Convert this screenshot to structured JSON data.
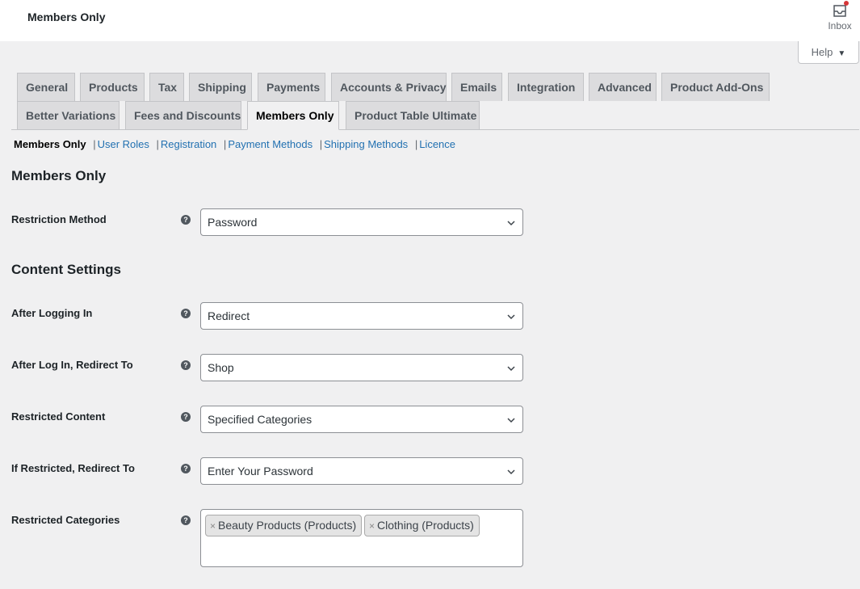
{
  "header": {
    "title": "Members Only",
    "inbox_label": "Inbox",
    "inbox_icon": "inbox-icon",
    "notification_color": "#d63638",
    "help_label": "Help",
    "help_caret": "▼"
  },
  "tabs": [
    {
      "label": "General"
    },
    {
      "label": "Products"
    },
    {
      "label": "Tax"
    },
    {
      "label": "Shipping"
    },
    {
      "label": "Payments"
    },
    {
      "label": "Accounts & Privacy"
    },
    {
      "label": "Emails"
    },
    {
      "label": "Integration"
    },
    {
      "label": "Advanced"
    },
    {
      "label": "Product Add-Ons"
    },
    {
      "label": "Better Variations"
    },
    {
      "label": "Fees and Discounts"
    },
    {
      "label": "Members Only",
      "active": true
    },
    {
      "label": "Product Table Ultimate"
    }
  ],
  "subnav": {
    "current": "Members Only",
    "links": [
      "User Roles",
      "Registration",
      "Payment Methods",
      "Shipping Methods",
      "Licence"
    ],
    "separator": "|"
  },
  "sections": {
    "members_only": {
      "heading": "Members Only",
      "restriction_method": {
        "label": "Restriction Method",
        "value": "Password"
      }
    },
    "content_settings": {
      "heading": "Content Settings",
      "after_logging_in": {
        "label": "After Logging In",
        "value": "Redirect"
      },
      "after_login_redirect": {
        "label": "After Log In, Redirect To",
        "value": "Shop"
      },
      "restricted_content": {
        "label": "Restricted Content",
        "value": "Specified Categories"
      },
      "if_restricted_redirect": {
        "label": "If Restricted, Redirect To",
        "value": "Enter Your Password"
      },
      "restricted_categories": {
        "label": "Restricted Categories",
        "selected": [
          "Beauty Products (Products)",
          "Clothing (Products)"
        ],
        "remove_glyph": "×"
      }
    }
  },
  "help_tip_glyph": "?",
  "accent_color": "#2271b1"
}
